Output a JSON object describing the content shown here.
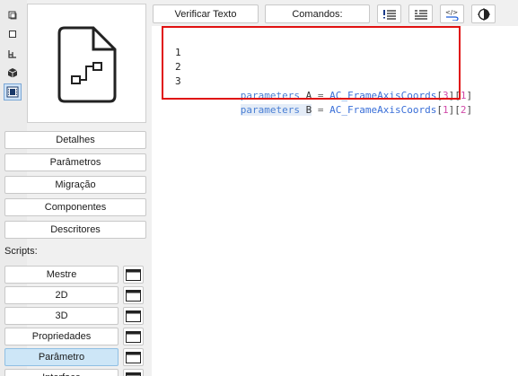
{
  "sidebar_buttons": {
    "details": "Detalhes",
    "parameters": "Parâmetros",
    "migration": "Migração",
    "components": "Componentes",
    "descriptors": "Descritores"
  },
  "scripts_label": "Scripts:",
  "scripts": [
    "Mestre",
    "2D",
    "3D",
    "Propriedades",
    "Parâmetro",
    "Interface"
  ],
  "selected_script": "Parâmetro",
  "toolbar": {
    "check_script": "Verificar Texto",
    "commands": "Comandos:"
  },
  "editor": {
    "lines": [
      {
        "number": "1",
        "keyword": "",
        "var": "",
        "op": "",
        "fn": "",
        "i1": "",
        "i2": ""
      },
      {
        "number": "2",
        "keyword": "parameters",
        "var": "A",
        "op": "=",
        "fn": "AC_FrameAxisCoords",
        "i1": "3",
        "i2": "1"
      },
      {
        "number": "3",
        "keyword": "parameters",
        "var": "B",
        "op": "=",
        "fn": "AC_FrameAxisCoords",
        "i1": "1",
        "i2": "2"
      }
    ]
  },
  "icons": {
    "strip": [
      "layer-copy-icon",
      "layer-icon",
      "floor-plan-icon",
      "3d-cube-icon",
      "film-strip-icon"
    ],
    "preview": "gdl-document-icon",
    "toolbar": [
      "list-important-icon",
      "list-text-icon",
      "code-wrap-icon",
      "contrast-icon"
    ]
  },
  "colors": {
    "selected_script_bg": "#cde6f7",
    "keyword": "#4a7fd4",
    "number": "#d14aa8",
    "highlight_box": "#e01010"
  }
}
